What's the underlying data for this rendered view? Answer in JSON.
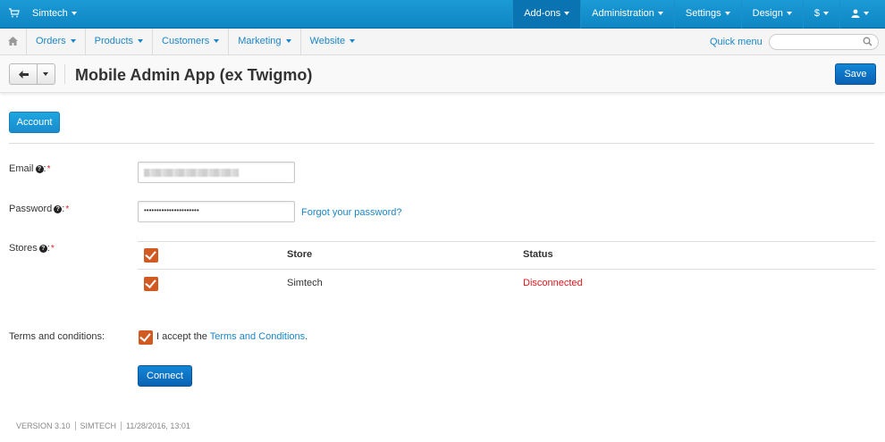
{
  "topbar": {
    "brand": "Simtech",
    "menu": [
      "Add-ons",
      "Administration",
      "Settings",
      "Design",
      "$",
      ""
    ]
  },
  "nav": {
    "items": [
      "Orders",
      "Products",
      "Customers",
      "Marketing",
      "Website"
    ],
    "quick_menu": "Quick menu",
    "search_placeholder": ""
  },
  "page": {
    "title": "Mobile Admin App (ex Twigmo)",
    "save_label": "Save"
  },
  "tab": {
    "account": "Account"
  },
  "form": {
    "email_label": "Email",
    "password_label": "Password",
    "password_value": "••••••••••••••••••••••",
    "forgot_link": "Forgot your password?",
    "stores_label": "Stores",
    "colon": ":",
    "required": "*",
    "help": "?"
  },
  "stores_table": {
    "headers": {
      "store": "Store",
      "status": "Status"
    },
    "rows": [
      {
        "store": "Simtech",
        "status": "Disconnected"
      }
    ]
  },
  "terms": {
    "label": "Terms and conditions:",
    "accept_prefix": "I accept the ",
    "accept_link": "Terms and Conditions",
    "accept_suffix": "."
  },
  "connect_label": "Connect",
  "footer": [
    "VERSION 3.10",
    "SIMTECH",
    "11/28/2016, 13:01"
  ],
  "colors": {
    "accent": "#1a86c8",
    "topbar": "#1b9bd6",
    "checkbox": "#d15a22",
    "error": "#e0181e"
  }
}
